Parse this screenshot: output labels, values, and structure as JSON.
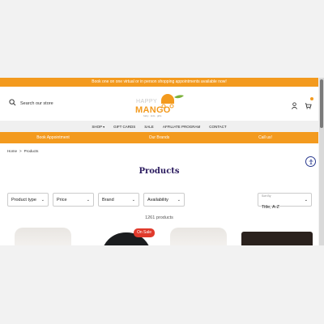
{
  "announcement": "Book one on one virtual or in person shopping appointments available now!",
  "search": {
    "placeholder": "Search our store"
  },
  "logo": {
    "line1": "HAPPY",
    "line2": "MANGO",
    "tagline": "baby . kids . gifts"
  },
  "nav": {
    "items": [
      "SHOP",
      "GIFT CARDS",
      "SALE",
      "AFFILIATE PROGRAM",
      "CONTACT"
    ]
  },
  "promo_bar": [
    "Book Appointment",
    "Our Brands",
    "Call us!"
  ],
  "breadcrumb": {
    "home": "Home",
    "separator": ">",
    "current": "Products"
  },
  "page_title": "Products",
  "filters": [
    "Product type",
    "Price",
    "Brand",
    "Availability"
  ],
  "sort": {
    "label": "Sort By",
    "value": "Title, A-Z"
  },
  "product_count": "1261 products",
  "badges": {
    "sale": "On Sale"
  },
  "colors": {
    "accent": "#f39a1e",
    "title": "#2a1a5e",
    "sale": "#e03a2c"
  },
  "icons": [
    "search-icon",
    "account-icon",
    "cart-icon",
    "accessibility-icon",
    "chevron-down-icon"
  ]
}
